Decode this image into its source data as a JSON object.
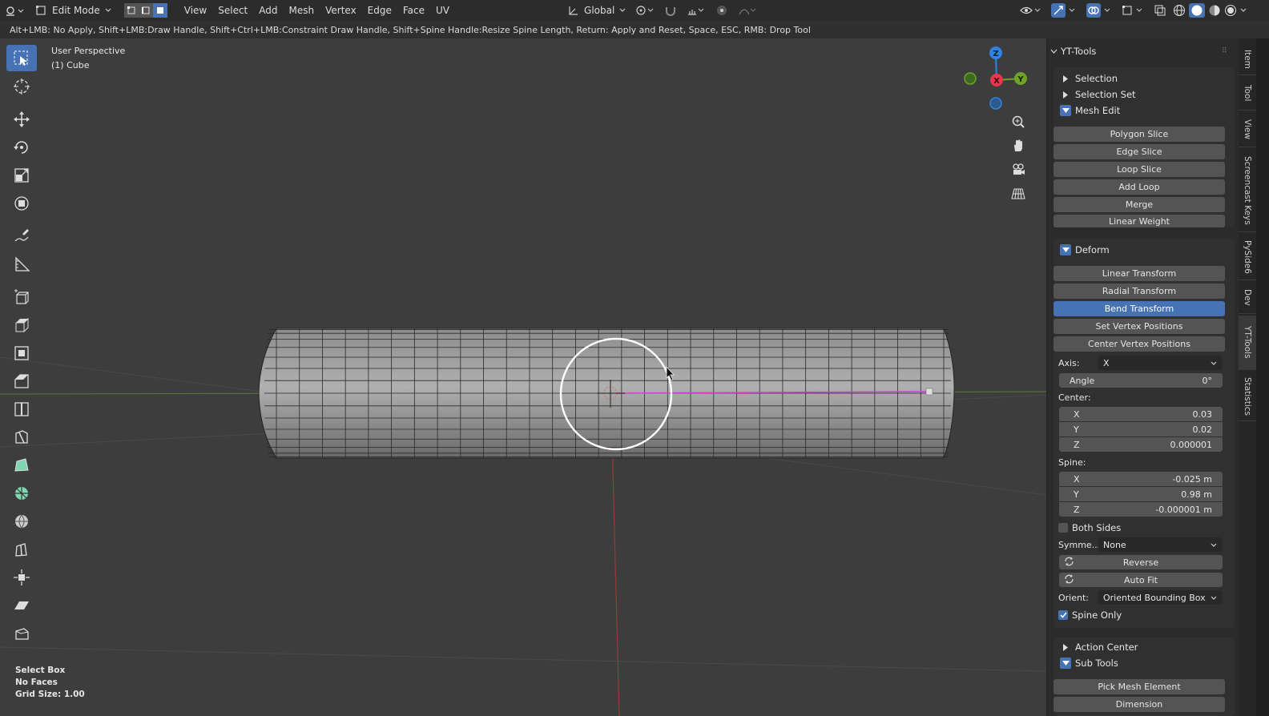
{
  "header": {
    "editor_icon": "editor-type-icon",
    "mode": "Edit Mode",
    "menus": [
      "View",
      "Select",
      "Add",
      "Mesh",
      "Vertex",
      "Edge",
      "Face",
      "UV"
    ],
    "orientation": "Global"
  },
  "hint_bar": {
    "text": "Alt+LMB: No Apply, Shift+LMB:Draw Handle, Shift+Ctrl+LMB:Constraint Draw Handle, Shift+Spine Handle:Resize Spine Length, Return: Apply and Reset, Space, ESC, RMB: Drop Tool"
  },
  "viewport": {
    "perspective_label": "User Perspective",
    "object_label": "(1) Cube",
    "status": {
      "operation": "Select Box",
      "faces": "No Faces",
      "grid": "Grid Size: 1.00"
    }
  },
  "gizmo": {
    "z": "Z",
    "x": "X",
    "y": "Y"
  },
  "npanel": {
    "title": "YT-Tools",
    "sections": {
      "selection": "Selection",
      "selection_set": "Selection Set",
      "mesh_edit": "Mesh Edit",
      "deform": "Deform",
      "action_center": "Action Center",
      "sub_tools": "Sub Tools"
    },
    "mesh_edit_buttons": [
      "Polygon Slice",
      "Edge Slice",
      "Loop Slice",
      "Add Loop",
      "Merge",
      "Linear Weight"
    ],
    "deform_buttons": [
      "Linear Transform",
      "Radial Transform",
      "Bend Transform",
      "Set Vertex Positions",
      "Center Vertex Positions"
    ],
    "active_button": "Bend Transform",
    "bend": {
      "axis_label": "Axis:",
      "axis_value": "X",
      "angle_label": "Angle",
      "angle_value": "0°",
      "center_label": "Center:",
      "center": [
        {
          "axis": "X",
          "value": "0.03"
        },
        {
          "axis": "Y",
          "value": "0.02"
        },
        {
          "axis": "Z",
          "value": "0.000001"
        }
      ],
      "spine_label": "Spine:",
      "spine": [
        {
          "axis": "X",
          "value": "-0.025 m"
        },
        {
          "axis": "Y",
          "value": "0.98 m"
        },
        {
          "axis": "Z",
          "value": "-0.000001 m"
        }
      ],
      "both_sides": "Both Sides",
      "both_sides_checked": false,
      "symmetry_label": "Symme...",
      "symmetry_value": "None",
      "reverse": "Reverse",
      "auto_fit": "Auto Fit",
      "orient_label": "Orient:",
      "orient_value": "Oriented Bounding Box",
      "spine_only": "Spine Only",
      "spine_only_checked": true
    },
    "sub_tools_buttons": [
      "Pick Mesh Element",
      "Dimension"
    ]
  },
  "side_tabs": [
    "Item",
    "Tool",
    "View",
    "Screencast Keys",
    "PySide6",
    "Dev",
    "YT-Tools",
    "Statistics"
  ],
  "active_tab": "YT-Tools",
  "colors": {
    "accent": "#4772b3",
    "axis_x": "#e8364f",
    "axis_y": "#6ea327",
    "axis_z": "#2f83e3",
    "spine": "#d040d0"
  }
}
